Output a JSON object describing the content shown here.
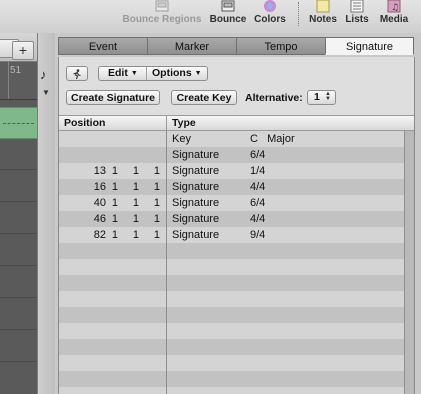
{
  "toolbar": {
    "bounce_regions": "Bounce Regions",
    "bounce": "Bounce",
    "colors": "Colors",
    "notes": "Notes",
    "lists": "Lists",
    "media": "Media"
  },
  "arrange": {
    "ruler_number": "51",
    "plus": "+"
  },
  "tabs": [
    "Event",
    "Marker",
    "Tempo",
    "Signature"
  ],
  "active_tab": "Signature",
  "controls": {
    "edit": "Edit",
    "options": "Options",
    "create_signature": "Create Signature",
    "create_key": "Create Key",
    "alternative_label": "Alternative:",
    "alternative_value": "1"
  },
  "table": {
    "columns": [
      "Position",
      "Type"
    ],
    "rows": [
      {
        "bar": "",
        "beat": "",
        "div": "",
        "tick": "",
        "type": "Key",
        "value": "C   Major"
      },
      {
        "bar": "",
        "beat": "",
        "div": "",
        "tick": "",
        "type": "Signature",
        "value": "6/4"
      },
      {
        "bar": "13",
        "beat": "1",
        "div": "1",
        "tick": "1",
        "type": "Signature",
        "value": "1/4"
      },
      {
        "bar": "16",
        "beat": "1",
        "div": "1",
        "tick": "1",
        "type": "Signature",
        "value": "4/4"
      },
      {
        "bar": "40",
        "beat": "1",
        "div": "1",
        "tick": "1",
        "type": "Signature",
        "value": "6/4"
      },
      {
        "bar": "46",
        "beat": "1",
        "div": "1",
        "tick": "1",
        "type": "Signature",
        "value": "4/4"
      },
      {
        "bar": "82",
        "beat": "1",
        "div": "1",
        "tick": "1",
        "type": "Signature",
        "value": "9/4"
      }
    ]
  },
  "colors": {
    "region_green": "#7fb98a",
    "panel_bg": "#c9c9c9",
    "row_light": "#d4d4d4",
    "row_dark": "#c2c2c2"
  }
}
